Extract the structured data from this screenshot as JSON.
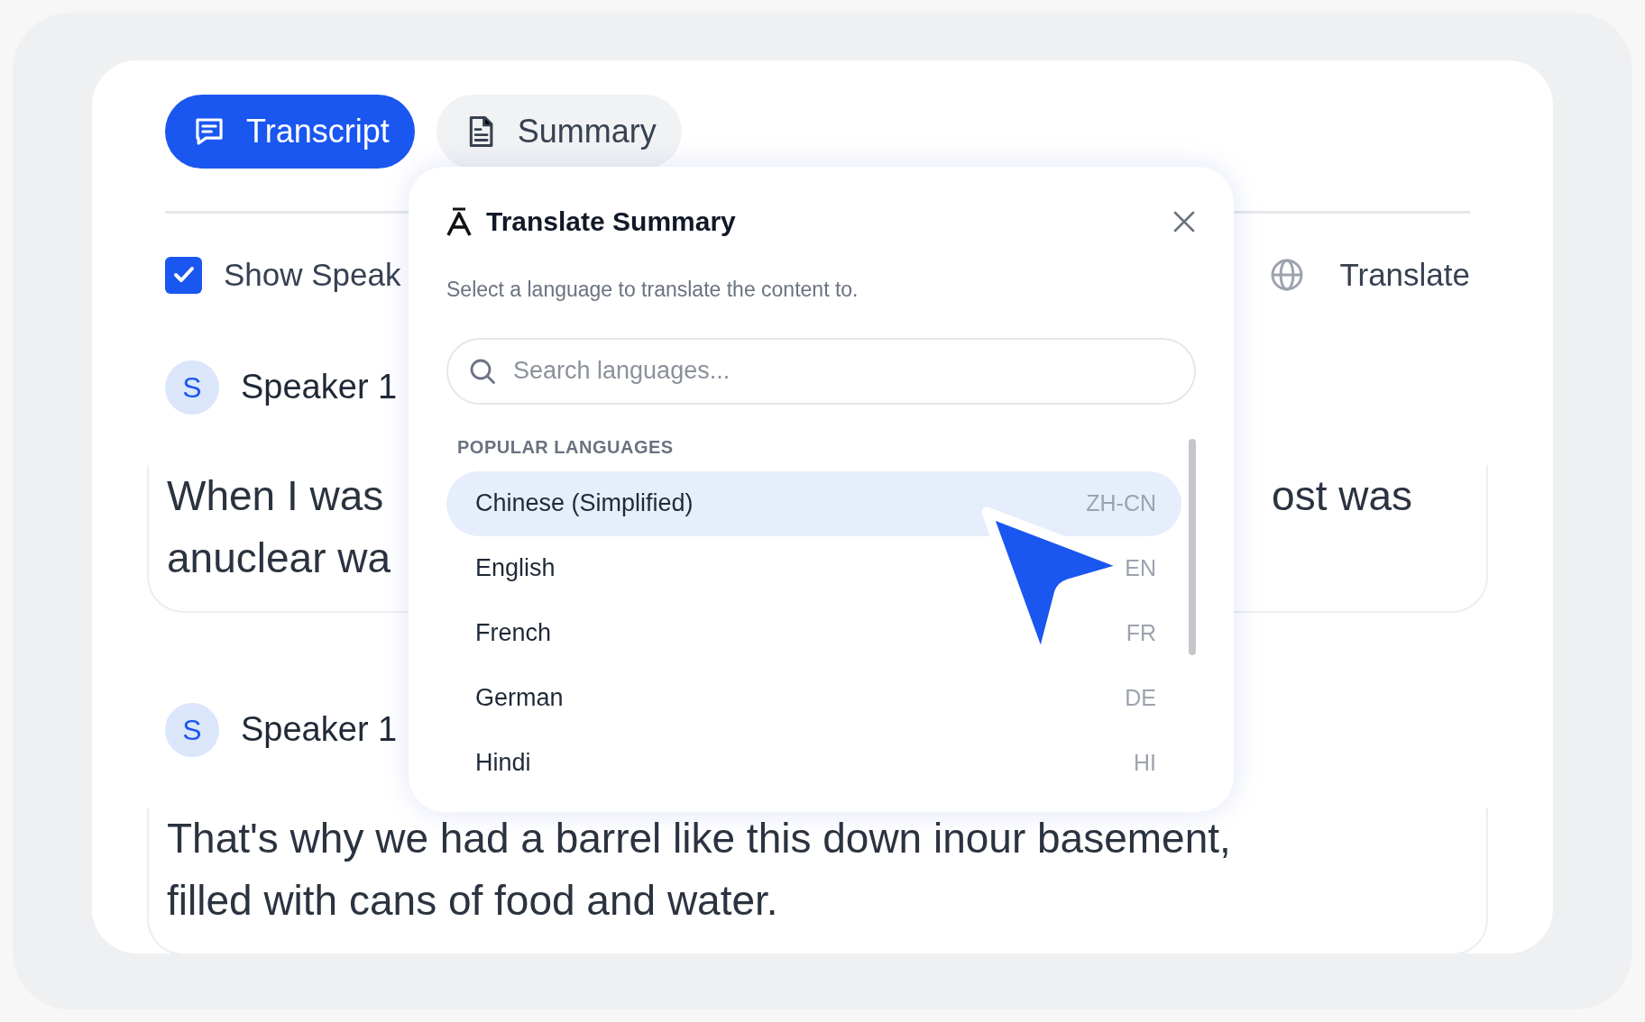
{
  "tabs": [
    {
      "label": "Transcript",
      "kind": "chat",
      "selected": true
    },
    {
      "label": "Summary",
      "kind": "document",
      "selected": false
    }
  ],
  "toolbar": {
    "show_speakers": {
      "label": "Show Speak",
      "checked": true
    },
    "translate": {
      "label": "Translate"
    }
  },
  "transcript": [
    {
      "initial": "S",
      "speaker": "Speaker 1",
      "lines": [
        {
          "left": "When I was",
          "right": "ost was"
        },
        {
          "left": "anuclear wa"
        }
      ]
    },
    {
      "initial": "S",
      "speaker": "Speaker 1",
      "lines": [
        {
          "left": "That's why we had a barrel like this down inour basement,"
        },
        {
          "left": "filled with cans of food and water."
        }
      ]
    }
  ],
  "dialog": {
    "title": "Translate Summary",
    "subtitle": "Select a language to translate the content to.",
    "search": {
      "placeholder": "Search languages..."
    },
    "section": "POPULAR LANGUAGES",
    "languages": [
      {
        "name": "Chinese (Simplified)",
        "code": "ZH-CN",
        "selected": true
      },
      {
        "name": "English",
        "code": "EN",
        "selected": false
      },
      {
        "name": "French",
        "code": "FR",
        "selected": false
      },
      {
        "name": "German",
        "code": "DE",
        "selected": false
      },
      {
        "name": "Hindi",
        "code": "HI",
        "selected": false
      }
    ]
  }
}
